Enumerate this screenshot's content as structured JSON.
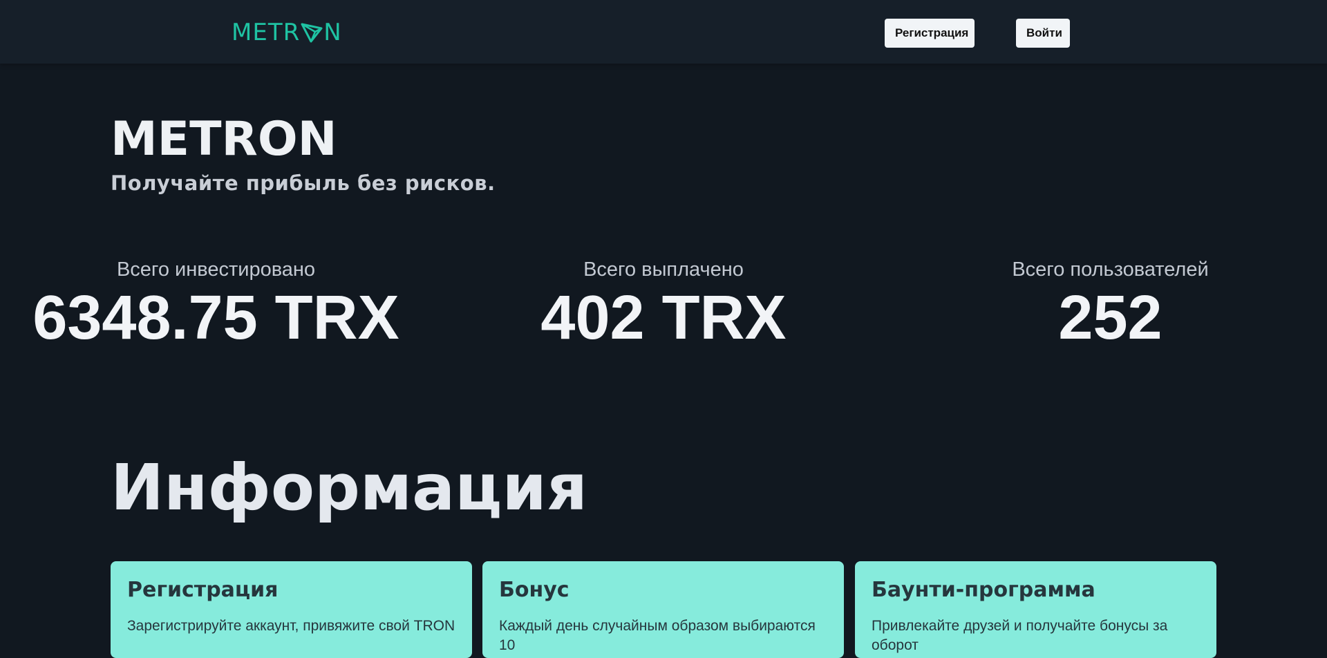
{
  "nav": {
    "logo_prefix": "METR",
    "logo_suffix": "N",
    "logo_icon": "tron-triangle-icon",
    "register_label": "Регистрация",
    "login_label": "Войти"
  },
  "hero": {
    "title": "METRON",
    "subtitle": "Получайте прибыль без рисков."
  },
  "stats": [
    {
      "label": "Всего инвестировано",
      "value": "6348.75 TRX"
    },
    {
      "label": "Всего выплачено",
      "value": "402 TRX"
    },
    {
      "label": "Всего пользователей",
      "value": "252"
    }
  ],
  "info": {
    "title": "Информация",
    "cards": [
      {
        "title": "Регистрация",
        "text": "Зарегистрируйте аккаунт, привяжите свой TRON"
      },
      {
        "title": "Бонус",
        "text": "Каждый день случайным образом выбираются 10"
      },
      {
        "title": "Баунти-программа",
        "text": "Привлекайте друзей и получайте бонусы за оборот"
      }
    ]
  },
  "colors": {
    "background": "#111820",
    "navbar": "#161f29",
    "accent": "#1fc3a3",
    "card": "#86ebdc"
  }
}
